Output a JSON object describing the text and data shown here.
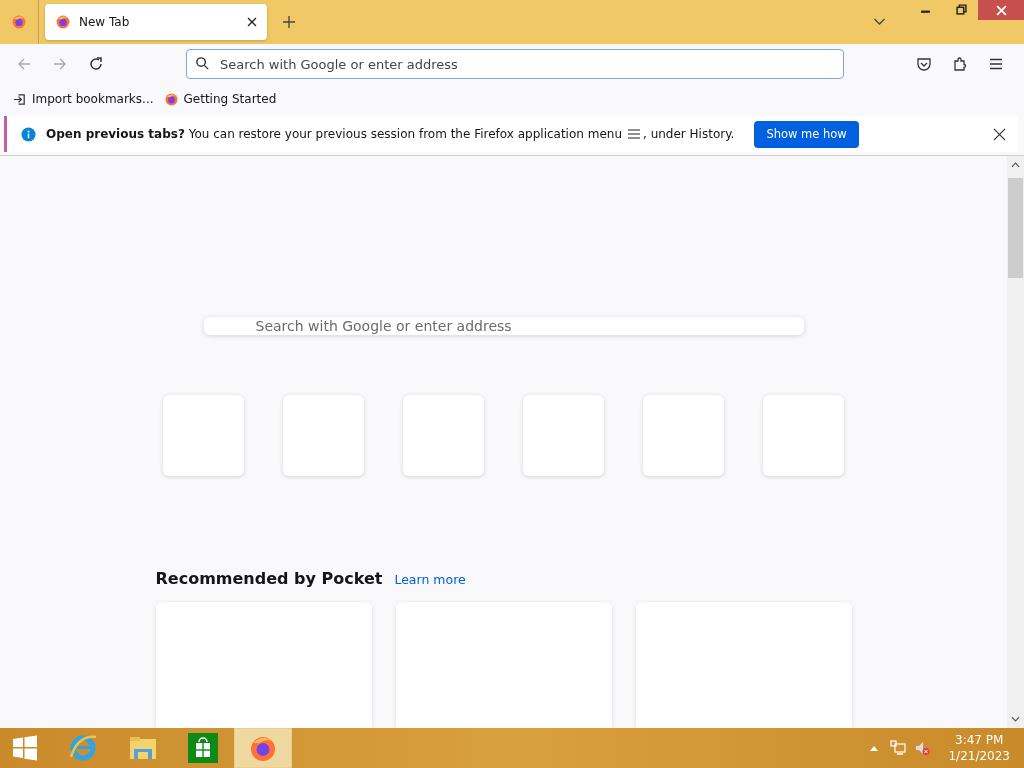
{
  "tabs": [
    {
      "title": "New Tab",
      "selected": true
    }
  ],
  "address_bar": {
    "placeholder": "Search with Google or enter address"
  },
  "bookmarks": [
    {
      "kind": "import",
      "label": "Import bookmarks..."
    },
    {
      "kind": "firefox",
      "label": "Getting Started"
    }
  ],
  "notification": {
    "message": "**Open previous tabs?** You can restore your previous session from the Firefox application menu",
    "message_end": ", under History.",
    "button": "Show me how"
  },
  "new_tab": {
    "search_placeholder": "Search with Google or enter address",
    "pocket_title": "Recommended by Pocket",
    "pocket_link": "Learn more"
  },
  "taskbar": {
    "apps": [
      {
        "kind": "ie",
        "selected": false
      },
      {
        "kind": "explorer",
        "selected": false
      },
      {
        "kind": "store",
        "selected": false
      },
      {
        "kind": "firefox",
        "selected": true
      }
    ],
    "time": "3:47 PM",
    "date": "1/21/2023"
  }
}
